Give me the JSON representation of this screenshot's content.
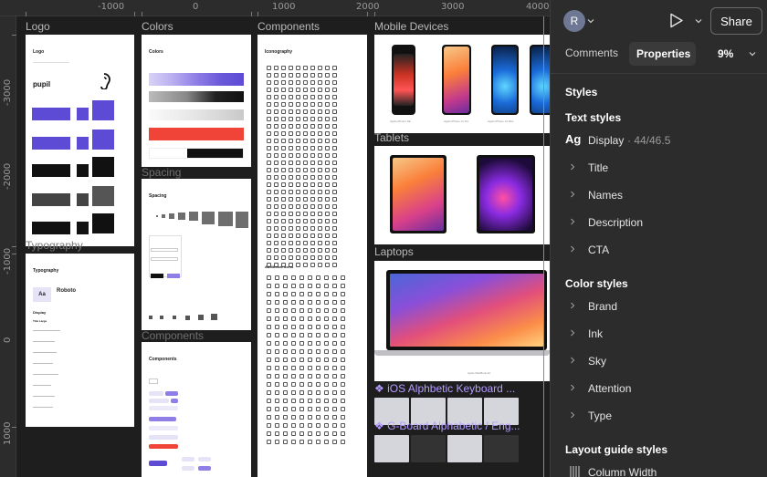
{
  "ruler": {
    "top_labels": [
      "-1000",
      "0",
      "1000",
      "2000",
      "3000",
      "4000"
    ],
    "left_labels": [
      "-3000",
      "-2000",
      "-1000",
      "0",
      "1000"
    ]
  },
  "canvas": {
    "frames": {
      "logo": "Logo",
      "colors": "Colors",
      "components": "Components",
      "mobile": "Mobile Devices",
      "tablets": "Tablets",
      "laptops": "Laptops",
      "spacing": "Spacing",
      "typography": "Typography",
      "components2": "Components",
      "ios_keyboard": "❖ iOS Alphbetic Keyboard ...",
      "gboard": "❖ G-Board Alphabetic / Eng..."
    },
    "logo_frame": {
      "title": "Logo",
      "brand": "pupil"
    },
    "colors_frame": {
      "title": "Colors"
    },
    "icon_frame": {
      "title": "Iconography",
      "subtitle": "Additional Icons"
    },
    "spacing_frame": {
      "title": "Spacing"
    },
    "typography_frame": {
      "title": "Typography",
      "font_sample": "Aa",
      "font_name": "Roboto",
      "display": "Display",
      "title_large": "Title Large"
    },
    "components_frame": {
      "title": "Components"
    },
    "mobile_captions": [
      "Apple iPhone SE",
      "Apple iPhone 11 Pro",
      "Apple iPhone 12 Mini",
      "Apple iPhone 12"
    ],
    "laptop_caption": "Apple MacBook Air"
  },
  "panel": {
    "avatar_initial": "R",
    "share_label": "Share",
    "tabs": {
      "comments": "Comments",
      "properties": "Properties"
    },
    "zoom": "9%",
    "styles_heading": "Styles",
    "text_styles": {
      "heading": "Text styles",
      "display": {
        "icon": "Ag",
        "label": "Display",
        "meta": "· 44/46.5"
      },
      "items": [
        "Title",
        "Names",
        "Description",
        "CTA"
      ]
    },
    "color_styles": {
      "heading": "Color styles",
      "items": [
        "Brand",
        "Ink",
        "Sky",
        "Attention",
        "Type"
      ]
    },
    "layout_styles": {
      "heading": "Layout guide styles",
      "items": [
        {
          "icon": "column-grid-icon",
          "label": "Column Width"
        }
      ]
    }
  },
  "colors": {
    "accent": "#5d4bd6",
    "panel_bg": "#2c2c2c",
    "canvas_bg": "#1e1e1e"
  }
}
